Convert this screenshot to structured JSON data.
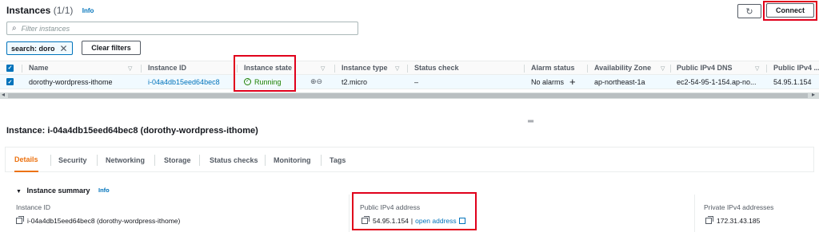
{
  "header": {
    "title": "Instances",
    "count": "(1/1)",
    "info": "Info",
    "refresh_icon": "refresh-icon",
    "connect_label": "Connect"
  },
  "search": {
    "placeholder": "Filter instances"
  },
  "filters": {
    "token": "search: doro",
    "clear_label": "Clear filters"
  },
  "table": {
    "columns": [
      "Name",
      "Instance ID",
      "Instance state",
      "Instance type",
      "Status check",
      "Alarm status",
      "Availability Zone",
      "Public IPv4 DNS",
      "Public IPv4 ..."
    ],
    "row": {
      "name": "dorothy-wordpress-ithome",
      "instance_id": "i-04a4db15eed64bec8",
      "state": "Running",
      "type": "t2.micro",
      "status_check": "–",
      "alarm": "No alarms",
      "alarm_add": "+",
      "az": "ap-northeast-1a",
      "dns": "ec2-54-95-1-154.ap-no...",
      "ipv4": "54.95.1.154"
    }
  },
  "detail": {
    "title": "Instance: i-04a4db15eed64bec8 (dorothy-wordpress-ithome)",
    "tabs": [
      "Details",
      "Security",
      "Networking",
      "Storage",
      "Status checks",
      "Monitoring",
      "Tags"
    ],
    "active_tab": "Details",
    "summary_label": "Instance summary",
    "summary_info": "Info",
    "fields": {
      "instance_id_label": "Instance ID",
      "instance_id_value": "i-04a4db15eed64bec8 (dorothy-wordpress-ithome)",
      "public_ip_label": "Public IPv4 address",
      "public_ip_value": "54.95.1.154",
      "public_ip_sep": "|",
      "open_address": "open address",
      "private_ip_label": "Private IPv4 addresses",
      "private_ip_value": "172.31.43.185"
    }
  },
  "colors": {
    "accent": "#0073bb",
    "running": "#1d8102",
    "highlight": "#e0001b",
    "active_tab": "#ec7211"
  }
}
